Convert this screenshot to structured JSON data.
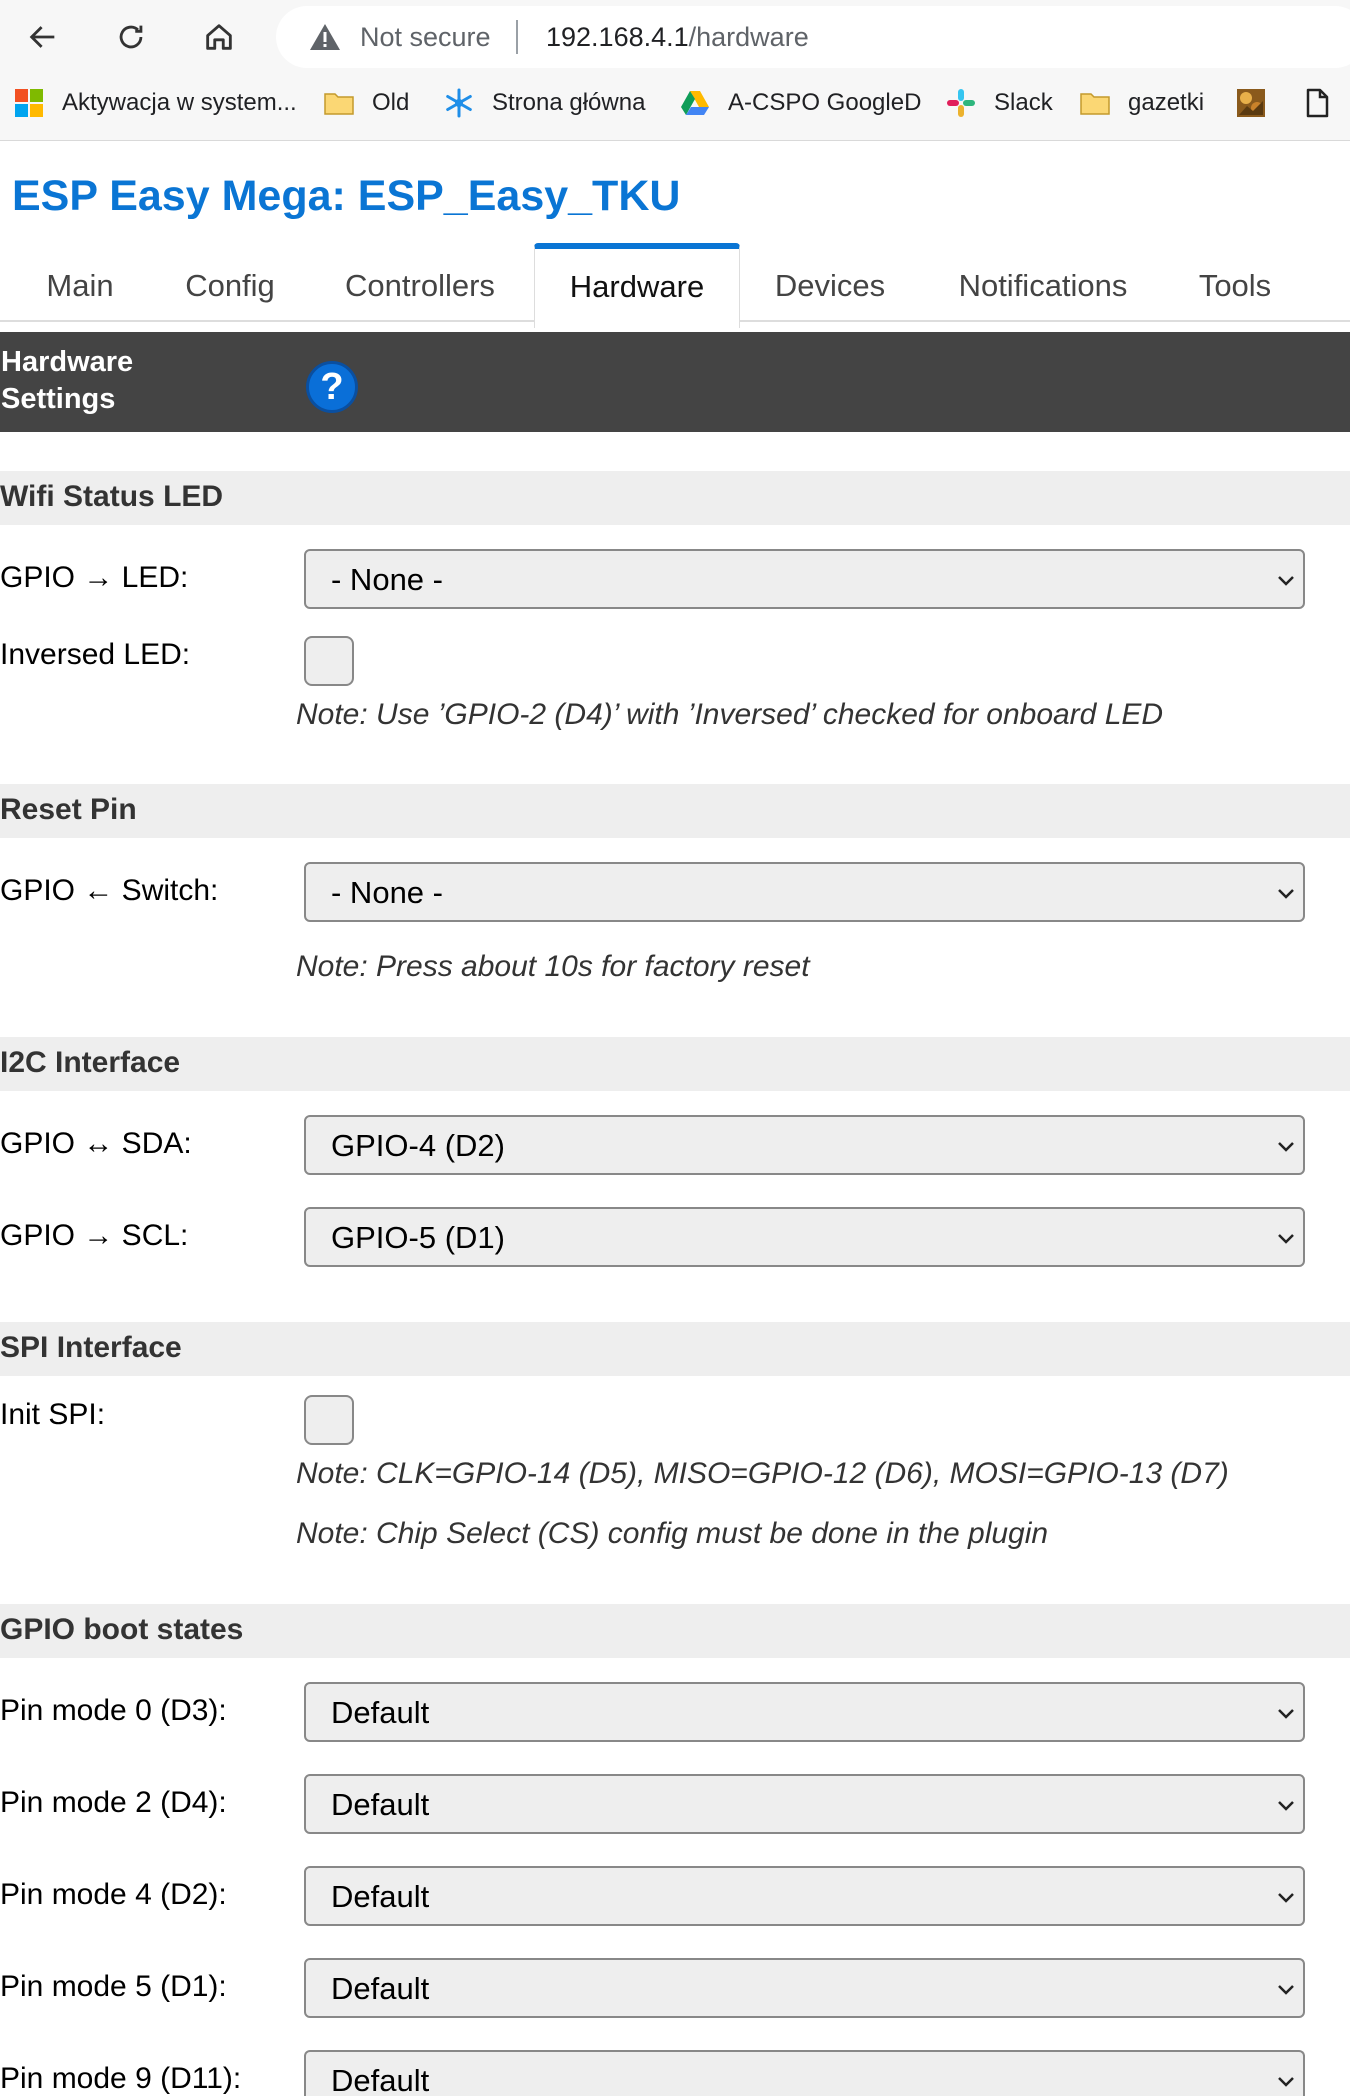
{
  "browser": {
    "security_text": "Not secure",
    "url_host": "192.168.4.1",
    "url_path": "/hardware",
    "bookmarks": [
      {
        "label": "Aktywacja w system...",
        "icon": "windows-logo-icon"
      },
      {
        "label": "Old",
        "icon": "folder-icon"
      },
      {
        "label": "Strona główna",
        "icon": "snowflake-icon"
      },
      {
        "label": "A-CSPO GoogleD",
        "icon": "google-drive-icon"
      },
      {
        "label": "Slack",
        "icon": "slack-icon"
      },
      {
        "label": "gazetki",
        "icon": "folder-icon"
      },
      {
        "label": "",
        "icon": "image-favicon-icon"
      },
      {
        "label": "",
        "icon": "page-icon"
      }
    ]
  },
  "page": {
    "title": "ESP Easy Mega: ESP_Easy_TKU",
    "tabs": [
      "Main",
      "Config",
      "Controllers",
      "Hardware",
      "Devices",
      "Notifications",
      "Tools"
    ],
    "active_tab": "Hardware",
    "header": {
      "line1": "Hardware",
      "line2": "Settings",
      "help_glyph": "?"
    }
  },
  "sections": {
    "wifi": {
      "title": "Wifi Status LED",
      "gpio_led_label": "GPIO → LED:",
      "gpio_led_value": "- None -",
      "inversed_label": "Inversed LED:",
      "inversed_checked": false,
      "note": "Note: Use ’GPIO-2 (D4)’ with ’Inversed’ checked for onboard LED"
    },
    "reset": {
      "title": "Reset Pin",
      "switch_label": "GPIO ← Switch:",
      "switch_value": "- None -",
      "note": "Note: Press about 10s for factory reset"
    },
    "i2c": {
      "title": "I2C Interface",
      "sda_label": "GPIO ↔ SDA:",
      "sda_value": "GPIO-4 (D2)",
      "scl_label": "GPIO → SCL:",
      "scl_value": "GPIO-5 (D1)"
    },
    "spi": {
      "title": "SPI Interface",
      "init_label": "Init SPI:",
      "init_checked": false,
      "note1": "Note: CLK=GPIO-14 (D5), MISO=GPIO-12 (D6), MOSI=GPIO-13 (D7)",
      "note2": "Note: Chip Select (CS) config must be done in the plugin"
    },
    "boot": {
      "title": "GPIO boot states",
      "pins": [
        {
          "label": "Pin mode 0 (D3):",
          "value": "Default"
        },
        {
          "label": "Pin mode 2 (D4):",
          "value": "Default"
        },
        {
          "label": "Pin mode 4 (D2):",
          "value": "Default"
        },
        {
          "label": "Pin mode 5 (D1):",
          "value": "Default"
        },
        {
          "label": "Pin mode 9 (D11):",
          "value": "Default"
        }
      ]
    }
  },
  "colors": {
    "title_blue": "#0a75d4",
    "header_bg": "#444444",
    "section_bg": "#eeeeee"
  }
}
